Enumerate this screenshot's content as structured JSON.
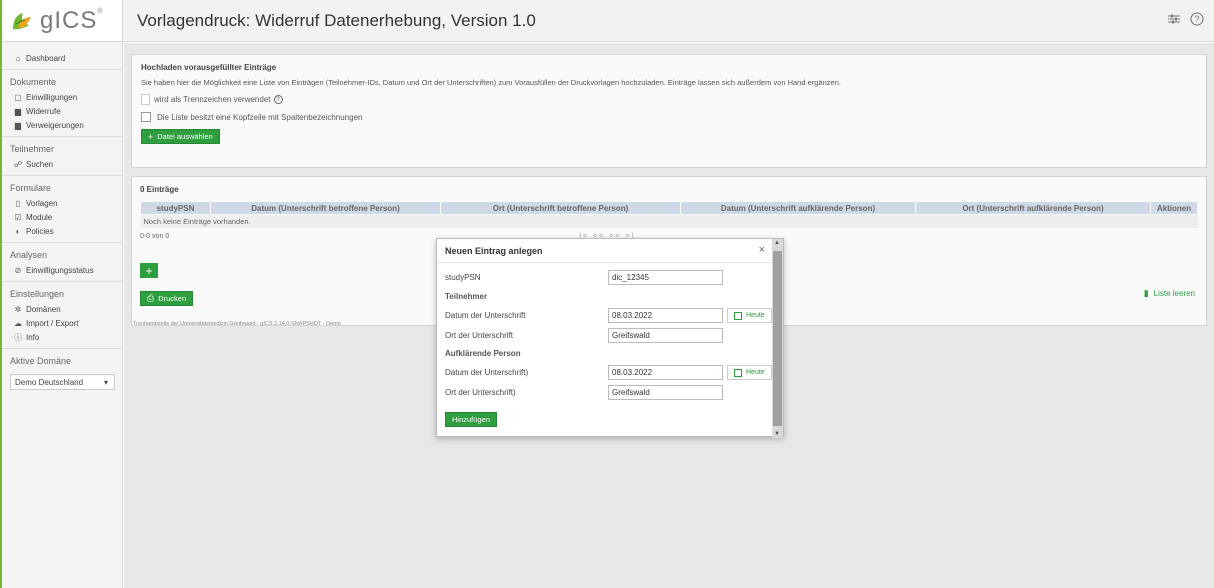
{
  "logo": {
    "text": "gICS",
    "reg": "®"
  },
  "header": {
    "title": "Vorlagendruck: Widerruf Datenerhebung, Version 1.0"
  },
  "sidebar": {
    "dashboard": "Dashboard",
    "dokumente": "Dokumente",
    "einwilligungen": "Einwilligungen",
    "widerrufe": "Widerrufe",
    "verweigerungen": "Verweigerungen",
    "teilnehmer": "Teilnehmer",
    "suchen": "Suchen",
    "formulare": "Formulare",
    "vorlagen": "Vorlagen",
    "module": "Module",
    "policies": "Policies",
    "analysen": "Analysen",
    "einwilligungsstatus": "Einwilligungsstatus",
    "einstellungen": "Einstellungen",
    "domaenen": "Domänen",
    "import_export": "Import / Export",
    "info": "Info",
    "aktive_domaene": "Aktive Domäne",
    "domain_value": "Demo Deutschland"
  },
  "upload": {
    "title": "Hochladen vorausgefüllter Einträge",
    "description": "Sie haben hier die Möglichkeit eine Liste von Einträgen (Teilnehmer-IDs, Datum und Ort der Unterschriften) zum Vorausfüllen der Druckvorlagen hochzuladen. Einträge lassen sich außerdem von Hand ergänzen.",
    "separator_label": "wird als Trennzeichen verwendet",
    "header_row_label": "Die Liste besitzt eine Kopfzeile mit Spaltenbezeichnungen",
    "choose_file": "Datei auswählen"
  },
  "entries": {
    "title": "0 Einträge",
    "columns": [
      "studyPSN",
      "Datum (Unterschrift betroffene Person)",
      "Ort (Unterschrift betroffene Person)",
      "Datum (Unterschrift aufklärende Person)",
      "Ort (Unterschrift aufklärende Person)",
      "Aktionen"
    ],
    "empty": "Noch keine Einträge vorhanden.",
    "paging": "0-0 von 0",
    "paging_ctrl": "|< << >> >|",
    "print": "Drucken",
    "clear": "Liste leeren"
  },
  "footer": "Treuhandstelle der Universitätsmedizin Greifswald - gICS 2.14.0-SNAPSHOT - Demo",
  "dialog": {
    "title": "Neuen Eintrag anlegen",
    "close": "×",
    "study_psn_label": "studyPSN",
    "study_psn_value": "dic_12345",
    "section_participant": "Teilnehmer",
    "date_label": "Datum der Unterschrift",
    "date_value": "08.03.2022",
    "today": "Heute",
    "place_label": "Ort der Unterschrift",
    "place_value": "Greifswald",
    "section_informant": "Aufklärende Person",
    "date_label2": "Datum der Unterschrift)",
    "date_value2": "08.03.2022",
    "place_label2": "Ort der Unterschrift)",
    "place_value2": "Greifswald",
    "add_button": "Hinzufügen"
  },
  "colors": {
    "accent": "#2e9e3e",
    "frame": "#6fb82f",
    "table_header": "#cfd8e6"
  }
}
